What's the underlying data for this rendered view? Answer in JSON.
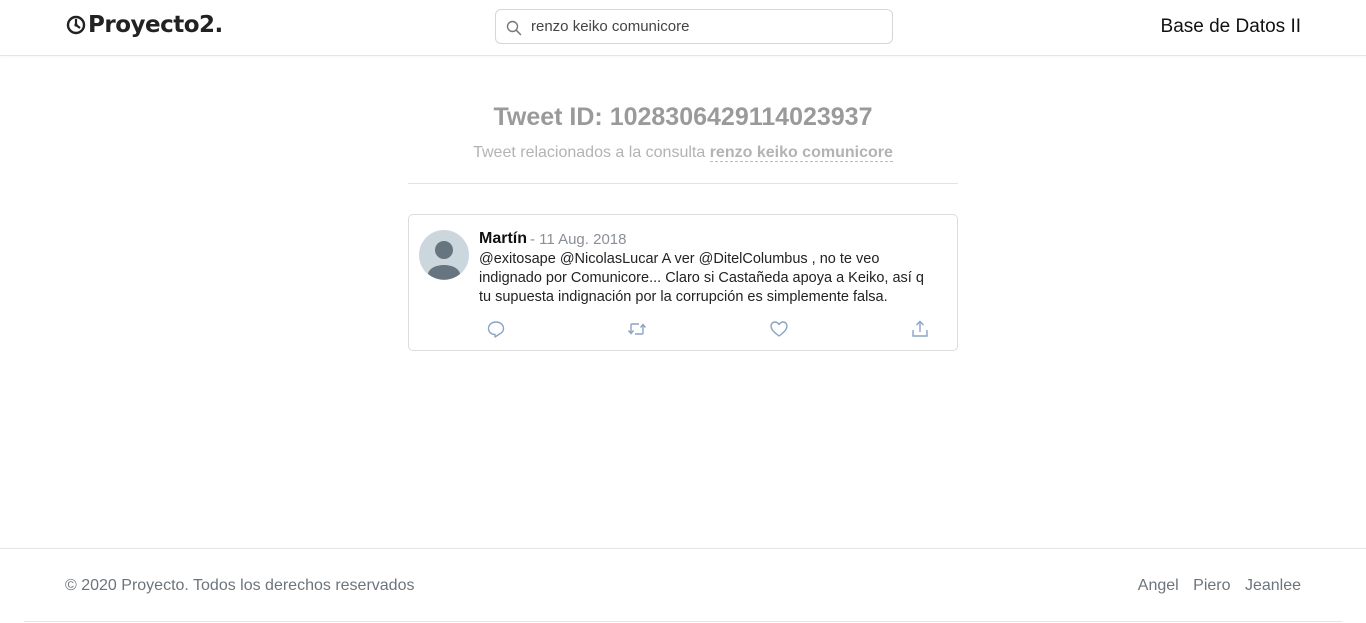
{
  "header": {
    "brand": "Proyecto2.",
    "brand_icon": "gear-clock-icon",
    "search": {
      "value": "renzo keiko comunicore",
      "icon": "search-icon"
    },
    "right_label": "Base de Datos II"
  },
  "main": {
    "title": "Tweet ID: 1028306429114023937",
    "subtitle_prefix": "Tweet relacionados a la consulta",
    "subtitle_query": "renzo keiko comunicore"
  },
  "tweet": {
    "author": "Martín",
    "date": "- 11 Aug. 2018",
    "text": "@exitosape @NicolasLucar A ver @DitelColumbus , no te veo indignado por Comunicore... Claro si Castañeda apoya a Keiko, así q tu supuesta indignación por la corrupción es simplemente falsa.",
    "actions": [
      "reply-icon",
      "retweet-icon",
      "like-icon",
      "share-icon"
    ]
  },
  "footer": {
    "copyright": "© 2020 Proyecto. Todos los derechos reservados",
    "links": [
      "Angel",
      "Piero",
      "Jeanlee"
    ]
  },
  "colors": {
    "heading": "#9a9a9a",
    "subtitle": "#b3b3b3",
    "action_icon": "#8aa4c4",
    "avatar_bg": "#ccd6dd",
    "avatar_fg": "#66757f"
  }
}
